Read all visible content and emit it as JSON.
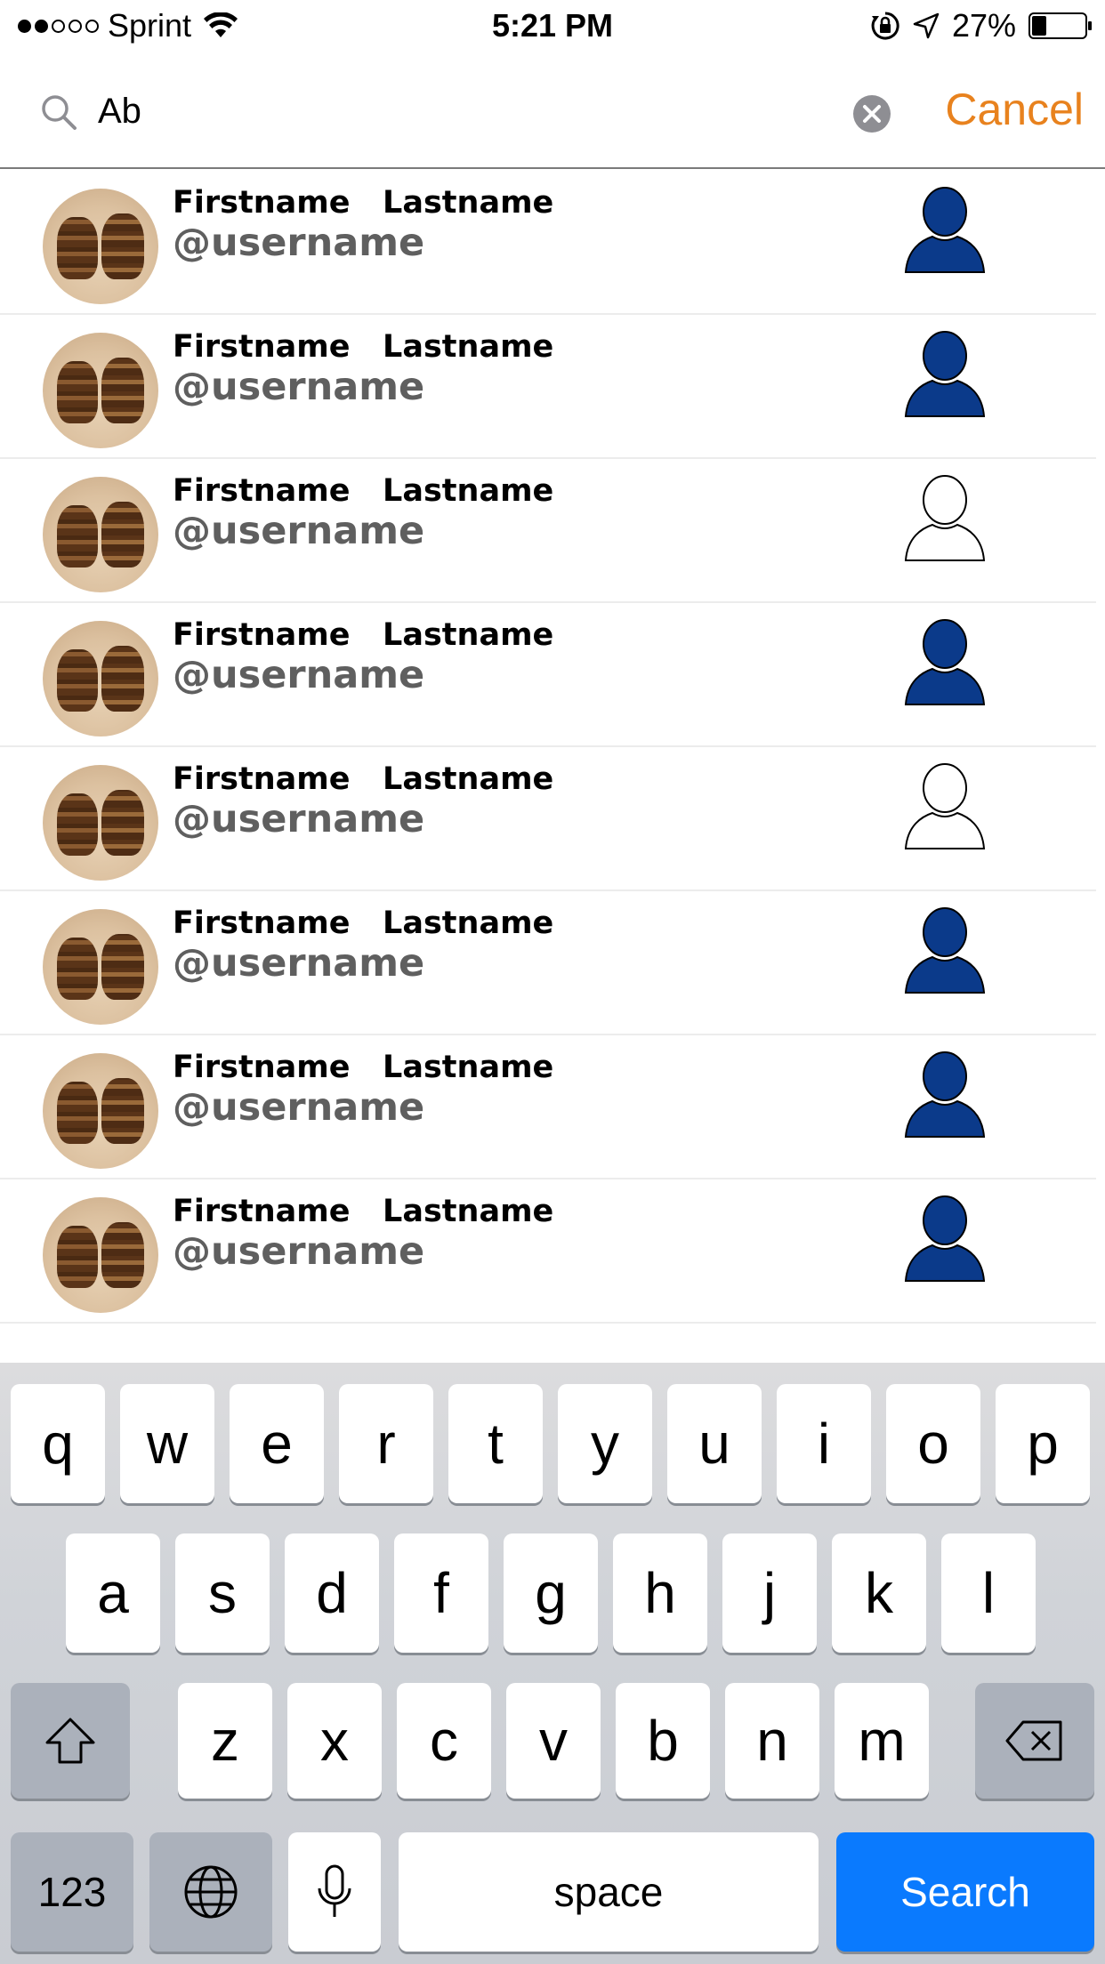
{
  "status_bar": {
    "carrier": "Sprint",
    "signal_strength": "2 of 5",
    "time": "5:21 PM",
    "battery": "27%"
  },
  "search": {
    "query": "Ab",
    "cancel_label": "Cancel"
  },
  "results": [
    {
      "first": "Firstname",
      "last": "Lastname",
      "username": "@username",
      "following": true
    },
    {
      "first": "Firstname",
      "last": "Lastname",
      "username": "@username",
      "following": true
    },
    {
      "first": "Firstname",
      "last": "Lastname",
      "username": "@username",
      "following": false
    },
    {
      "first": "Firstname",
      "last": "Lastname",
      "username": "@username",
      "following": true
    },
    {
      "first": "Firstname",
      "last": "Lastname",
      "username": "@username",
      "following": false
    },
    {
      "first": "Firstname",
      "last": "Lastname",
      "username": "@username",
      "following": true
    },
    {
      "first": "Firstname",
      "last": "Lastname",
      "username": "@username",
      "following": true
    },
    {
      "first": "Firstname",
      "last": "Lastname",
      "username": "@username",
      "following": true
    }
  ],
  "keyboard": {
    "row1": [
      "q",
      "w",
      "e",
      "r",
      "t",
      "y",
      "u",
      "i",
      "o",
      "p"
    ],
    "row2": [
      "a",
      "s",
      "d",
      "f",
      "g",
      "h",
      "j",
      "k",
      "l"
    ],
    "row3": [
      "z",
      "x",
      "c",
      "v",
      "b",
      "n",
      "m"
    ],
    "numbers_label": "123",
    "space_label": "space",
    "search_label": "Search"
  },
  "colors": {
    "accent": "#e8821e",
    "follow_fill": "#0b3a8a",
    "search_key": "#0a7afe"
  }
}
